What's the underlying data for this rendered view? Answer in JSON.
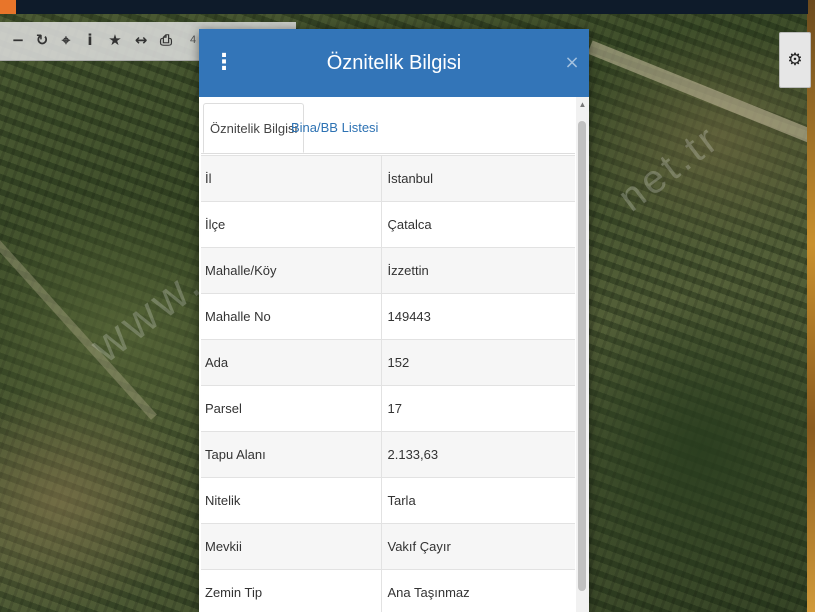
{
  "map": {
    "watermark": "www.",
    "watermark_right": "net.tr",
    "scale_text": "4"
  },
  "toolbar": {
    "tools": [
      {
        "name": "zoom-out-icon",
        "glyph": "−"
      },
      {
        "name": "refresh-icon",
        "glyph": "↻"
      },
      {
        "name": "locate-icon",
        "glyph": "⌖"
      },
      {
        "name": "info-icon",
        "glyph": "i"
      },
      {
        "name": "star-icon",
        "glyph": "★"
      },
      {
        "name": "measure-icon",
        "glyph": "↔"
      },
      {
        "name": "print-icon",
        "glyph": "⎙"
      }
    ]
  },
  "gear": {
    "glyph": "⚙"
  },
  "dialog": {
    "title": "Öznitelik Bilgisi",
    "menu_glyph": "⋮",
    "close_glyph": "×",
    "tabs": [
      {
        "label": "Öznitelik Bilgisi",
        "active": true
      },
      {
        "label": "Bina/BB Listesi",
        "active": false
      }
    ],
    "rows": [
      {
        "key": "İl",
        "value": "İstanbul"
      },
      {
        "key": "İlçe",
        "value": "Çatalca"
      },
      {
        "key": "Mahalle/Köy",
        "value": "İzzettin"
      },
      {
        "key": "Mahalle No",
        "value": "149443"
      },
      {
        "key": "Ada",
        "value": "152"
      },
      {
        "key": "Parsel",
        "value": "17"
      },
      {
        "key": "Tapu Alanı",
        "value": "2.133,63"
      },
      {
        "key": "Nitelik",
        "value": "Tarla"
      },
      {
        "key": "Mevkii",
        "value": "Vakıf Çayır"
      },
      {
        "key": "Zemin Tip",
        "value": "Ana Taşınmaz"
      }
    ]
  },
  "colors": {
    "header_blue": "#3375b8",
    "link_blue": "#2d72b3",
    "top_bar": "#0e1b2a",
    "accent_orange": "#e8752a"
  }
}
